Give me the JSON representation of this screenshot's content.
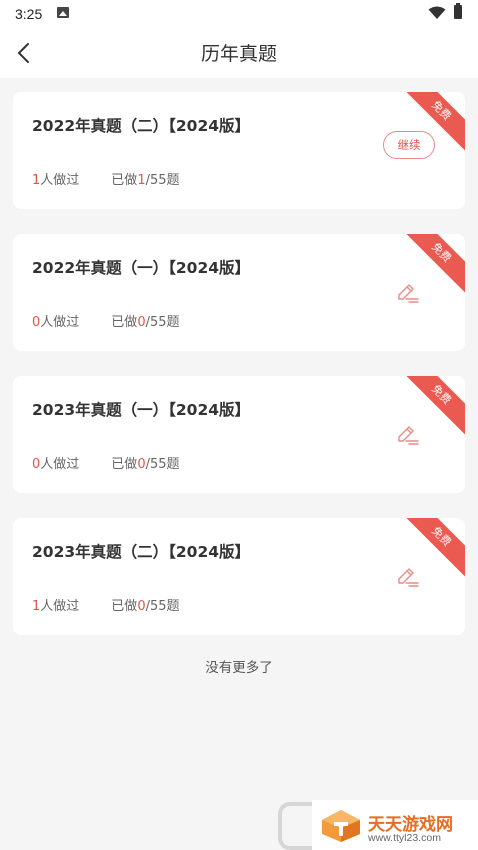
{
  "status_bar": {
    "time": "3:25"
  },
  "header": {
    "title": "历年真题"
  },
  "exams": [
    {
      "title": "2022年真题（二）【2024版】",
      "people_count": "1",
      "people_suffix": "人做过",
      "done_prefix": "已做",
      "done_count": "1",
      "done_total": "/55题",
      "badge": "免费",
      "action": "继续"
    },
    {
      "title": "2022年真题（一）【2024版】",
      "people_count": "0",
      "people_suffix": "人做过",
      "done_prefix": "已做",
      "done_count": "0",
      "done_total": "/55题",
      "badge": "免费",
      "action_icon": "pen-icon"
    },
    {
      "title": "2023年真题（一）【2024版】",
      "people_count": "0",
      "people_suffix": "人做过",
      "done_prefix": "已做",
      "done_count": "0",
      "done_total": "/55题",
      "badge": "免费",
      "action_icon": "pen-icon"
    },
    {
      "title": "2023年真题（二）【2024版】",
      "people_count": "1",
      "people_suffix": "人做过",
      "done_prefix": "已做",
      "done_count": "0",
      "done_total": "/55题",
      "badge": "免费",
      "action_icon": "pen-icon"
    }
  ],
  "footer": {
    "no_more": "没有更多了"
  },
  "watermark": {
    "name": "天天游戏网",
    "url": "www.ttyl23.com"
  },
  "colors": {
    "accent": "#e5544c",
    "background": "#f5f5f5"
  }
}
